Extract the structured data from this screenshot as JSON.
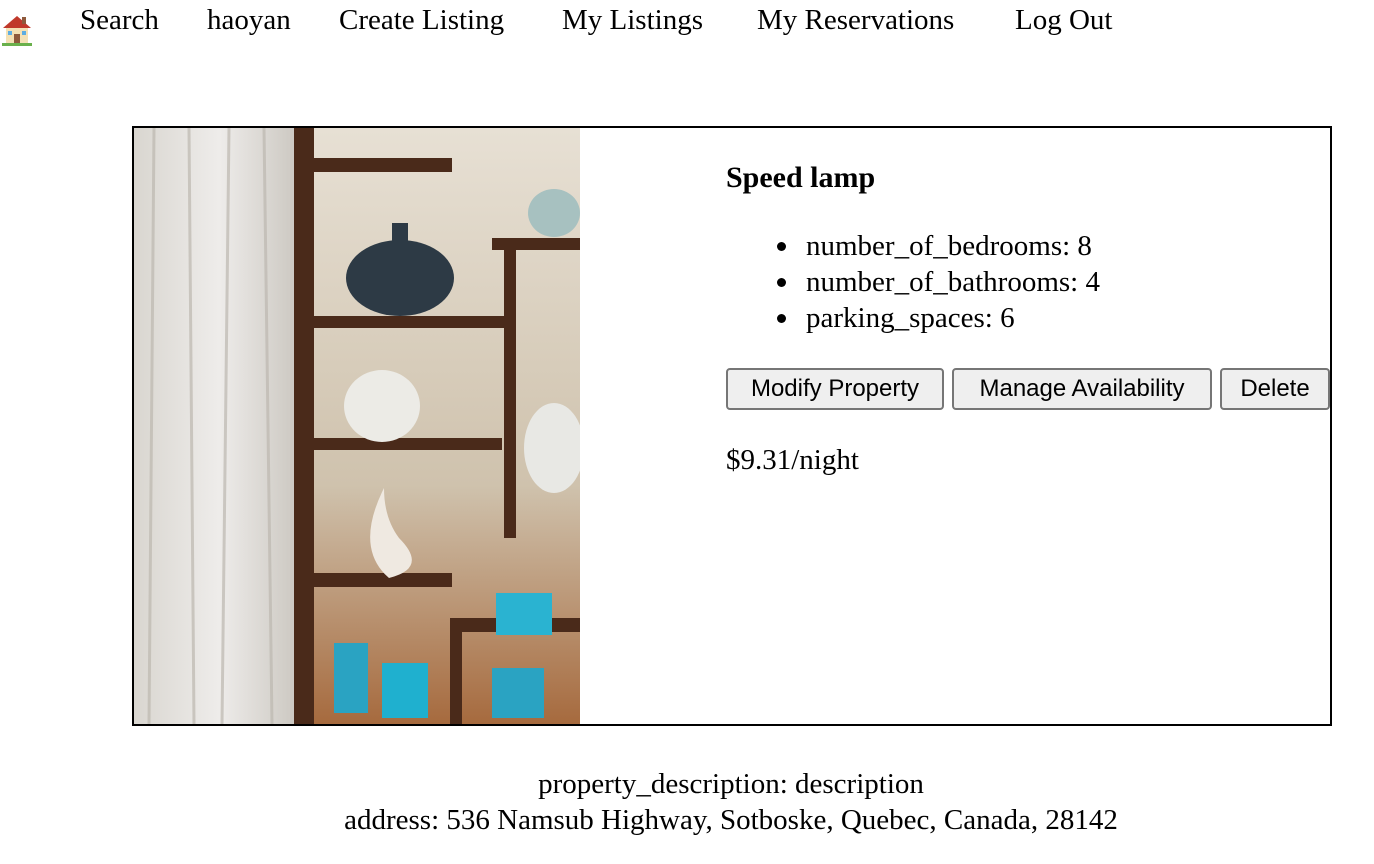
{
  "nav": {
    "home_icon": "house-icon",
    "links": [
      {
        "label": "Search"
      },
      {
        "label": "haoyan"
      },
      {
        "label": "Create Listing"
      },
      {
        "label": "My Listings"
      },
      {
        "label": "My Reservations"
      },
      {
        "label": "Log Out"
      }
    ]
  },
  "listing": {
    "title": "Speed lamp",
    "features": [
      "number_of_bedrooms: 8",
      "number_of_bathrooms: 4",
      "parking_spaces: 6"
    ],
    "buttons": {
      "modify": "Modify Property",
      "availability": "Manage Availability",
      "delete": "Delete"
    },
    "price": "$9.31/night"
  },
  "footer": {
    "description": "property_description: description",
    "address": "address: 536 Namsub Highway, Sotboske, Quebec, Canada, 28142"
  }
}
